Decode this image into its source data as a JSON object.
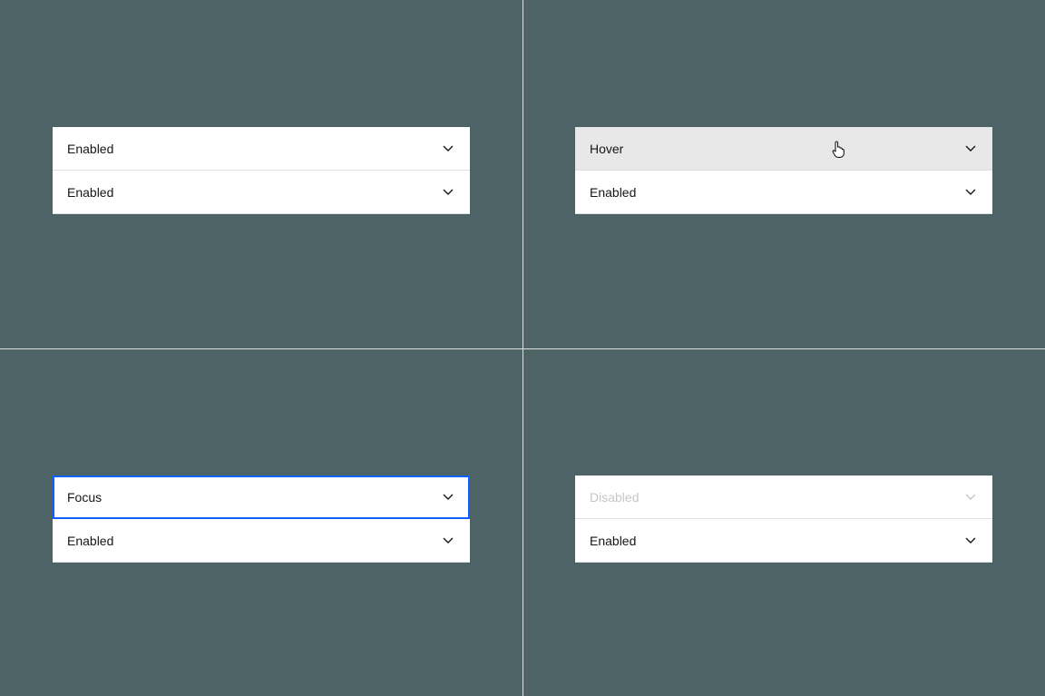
{
  "states": {
    "enabled": "Enabled",
    "hover": "Hover",
    "focus": "Focus",
    "disabled": "Disabled"
  },
  "quadrants": {
    "tl": {
      "row1": "Enabled",
      "row2": "Enabled"
    },
    "tr": {
      "row1": "Hover",
      "row2": "Enabled"
    },
    "bl": {
      "row1": "Focus",
      "row2": "Enabled"
    },
    "br": {
      "row1": "Disabled",
      "row2": "Enabled"
    }
  }
}
